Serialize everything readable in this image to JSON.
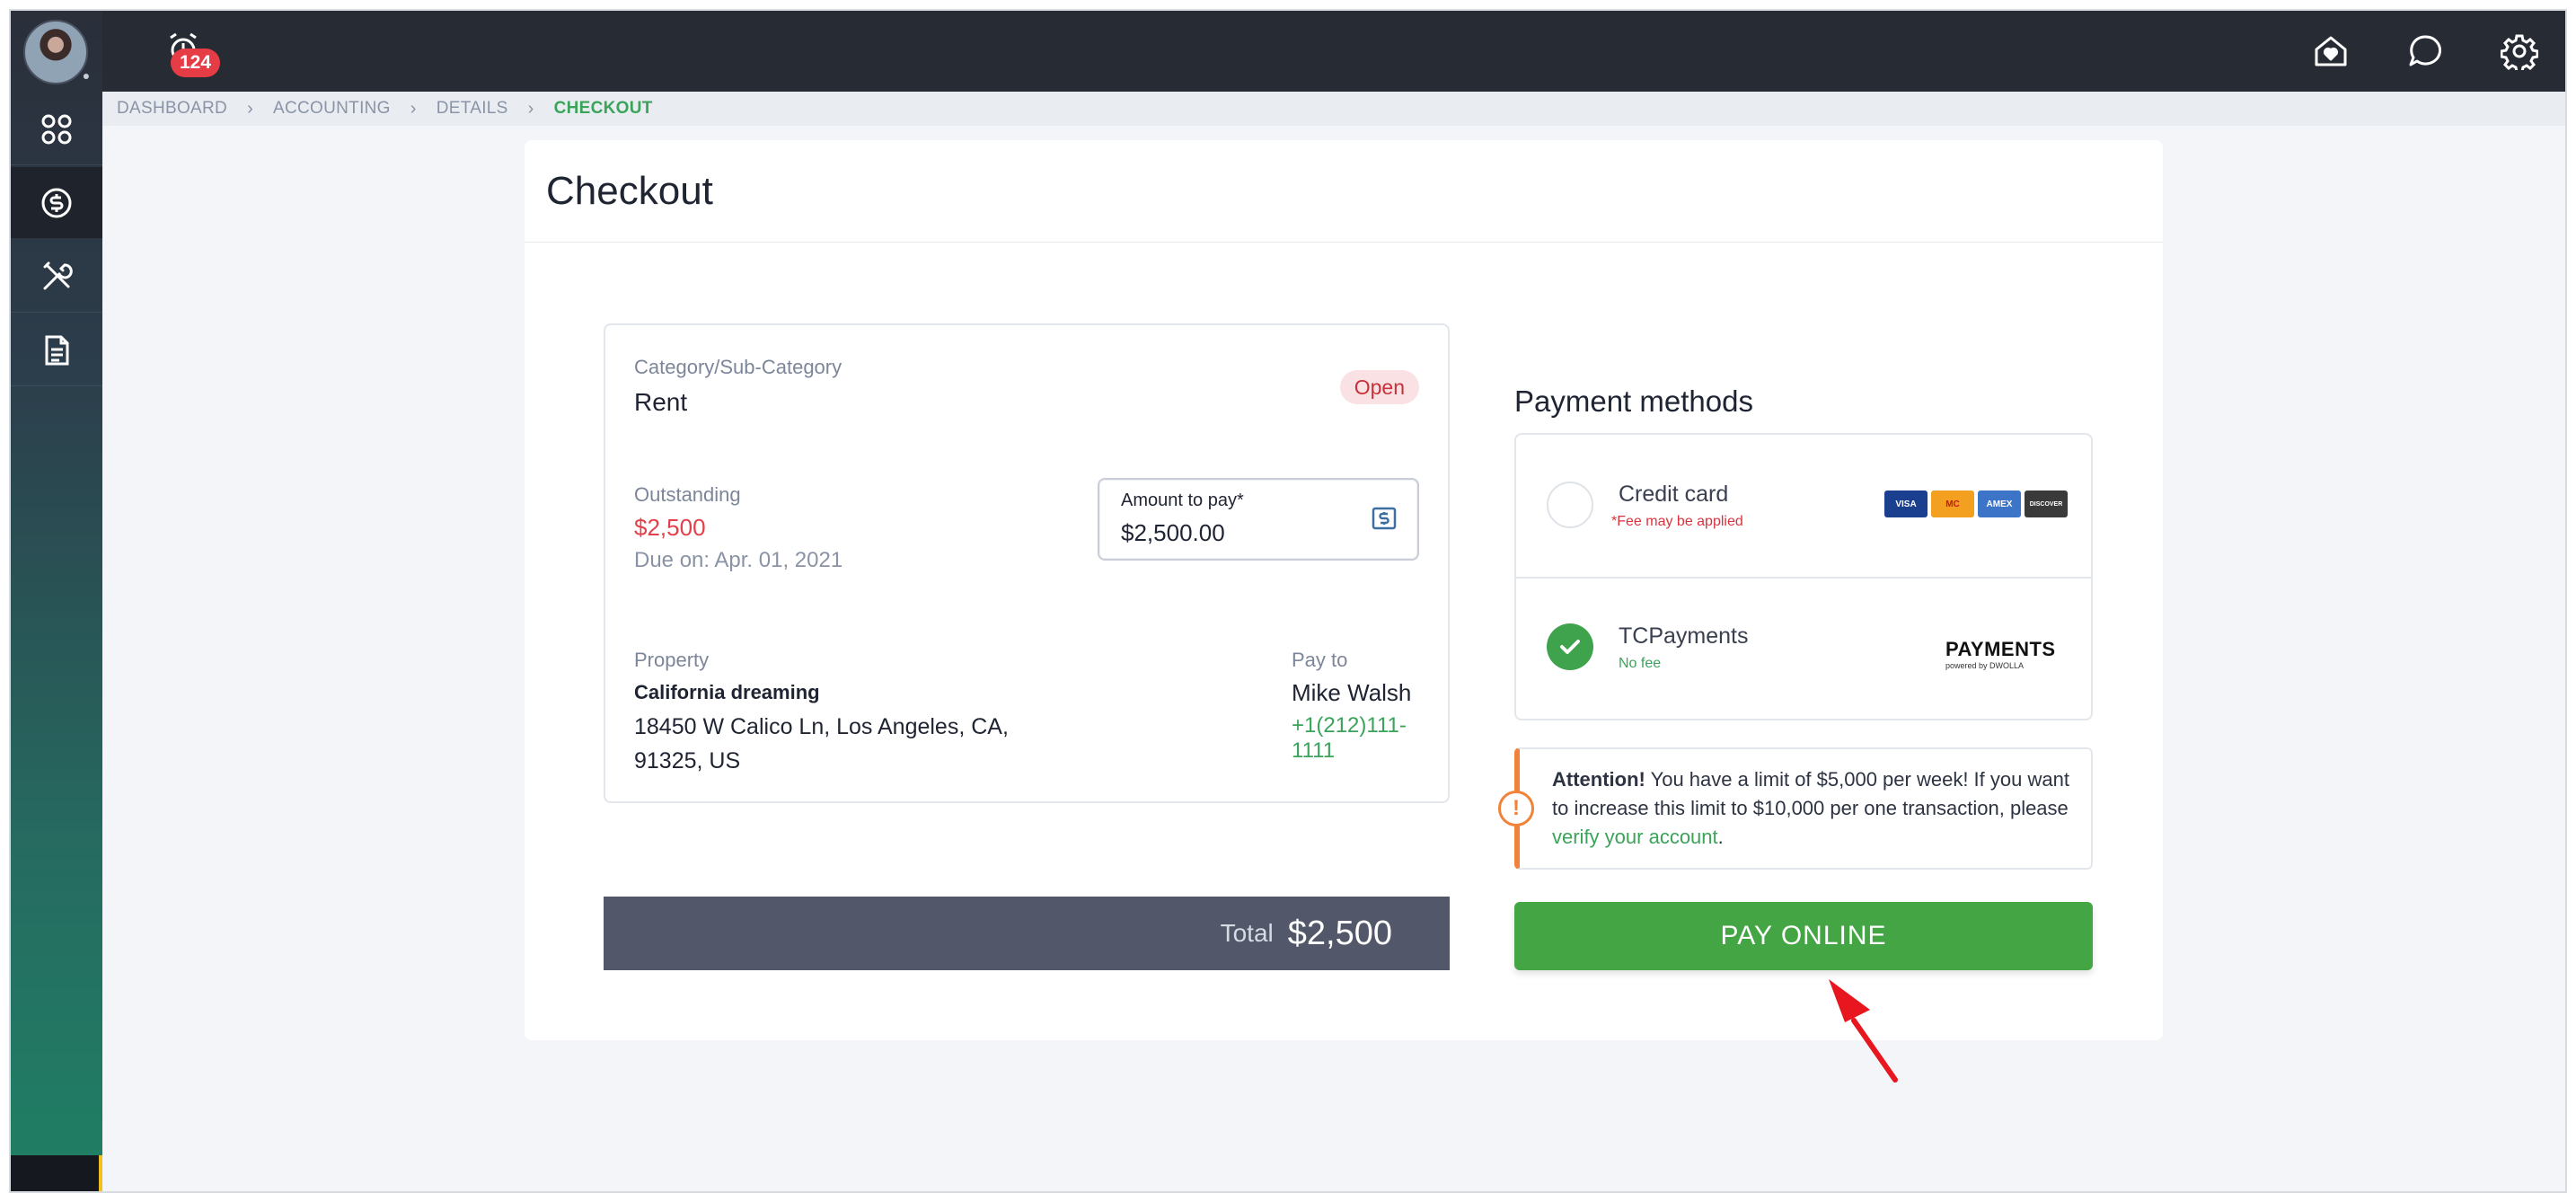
{
  "topbar": {
    "notification_count": "124",
    "icons": [
      "home-heart-icon",
      "chat-icon",
      "gear-icon"
    ]
  },
  "sidebar": {
    "items": [
      {
        "icon": "dashboard-grid-icon",
        "active": false
      },
      {
        "icon": "dollar-coin-icon",
        "active": true
      },
      {
        "icon": "tools-icon",
        "active": false
      },
      {
        "icon": "document-icon",
        "active": false
      }
    ]
  },
  "breadcrumb": [
    "DASHBOARD",
    "ACCOUNTING",
    "DETAILS",
    "CHECKOUT"
  ],
  "page_title": "Checkout",
  "invoice": {
    "category_label": "Category/Sub-Category",
    "category_value": "Rent",
    "status": "Open",
    "outstanding_label": "Outstanding",
    "outstanding_value": "$2,500",
    "due_label": "Due on:",
    "due_date": "Apr. 01, 2021",
    "amount_label": "Amount to pay*",
    "amount_value": "$2,500.00",
    "property_label": "Property",
    "property_name": "California dreaming",
    "property_address": "18450 W Calico Ln, Los Angeles, CA, 91325, US",
    "payto_label": "Pay to",
    "payto_name": "Mike Walsh",
    "payto_phone": "+1(212)111-1111"
  },
  "total": {
    "label": "Total",
    "value": "$2,500"
  },
  "payment_methods": {
    "title": "Payment methods",
    "options": [
      {
        "name": "Credit card",
        "note": "*Fee may be applied",
        "selected": false,
        "logos": [
          "VISA",
          "MC",
          "AMEX",
          "DISCOVER"
        ]
      },
      {
        "name": "TCPayments",
        "note": "No fee",
        "selected": true,
        "logo_word": "PAYMENTS",
        "logo_sub": "powered by DWOLLA"
      }
    ]
  },
  "attention": {
    "bold": "Attention!",
    "text": " You have a limit of $5,000 per week! If you want to increase this limit to $10,000 per one transaction, please ",
    "link": "verify your account",
    "end": "."
  },
  "pay_button_label": "PAY ONLINE",
  "colors": {
    "accent_green": "#44a544",
    "danger_red": "#e2404a",
    "warning_orange": "#f0823a",
    "topbar": "#272b33"
  }
}
